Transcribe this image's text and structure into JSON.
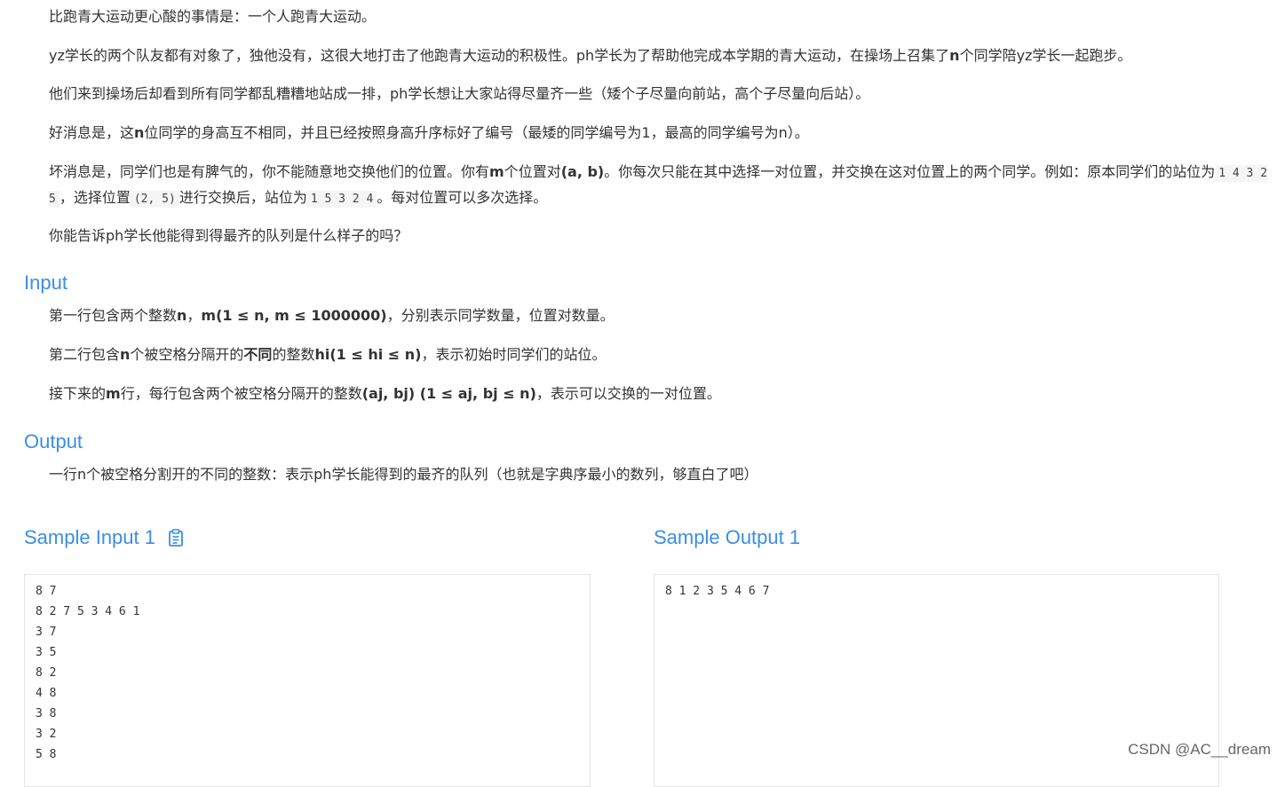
{
  "description": {
    "p1": "比跑青大运动更心酸的事情是：一个人跑青大运动。",
    "p2": {
      "a": "yz学长的两个队友都有对象了，独他没有，这很大地打击了他跑青大运动的积极性。ph学长为了帮助他完成本学期的青大运动，在操场上召集了",
      "b": "n",
      "c": "个同学陪yz学长一起跑步。"
    },
    "p3": "他们来到操场后却看到所有同学都乱糟糟地站成一排，ph学长想让大家站得尽量齐一些（矮个子尽量向前站，高个子尽量向后站）。",
    "p4": {
      "a": "好消息是，这",
      "b": "n",
      "c": "位同学的身高互不相同，并且已经按照身高升序标好了编号（最矮的同学编号为1，最高的同学编号为n）。"
    },
    "p5": {
      "a": "坏消息是，同学们也是有脾气的，你不能随意地交换他们的位置。你有",
      "b": "m",
      "c": "个位置对",
      "d": "(a, b)",
      "e": "。你每次只能在其中选择一对位置，并交换在这对位置上的两个同学。例如：原本同学们的站位为",
      "code1": "1 4 3 2 5",
      "f": "，选择位置",
      "code2": "(2, 5)",
      "g": "进行交换后，站位为",
      "code3": "1 5 3 2 4",
      "h": "。每对位置可以多次选择。"
    },
    "p6": "你能告诉ph学长他能得到得最齐的队列是什么样子的吗？"
  },
  "input_section": {
    "title": "Input",
    "line1": {
      "a": "第一行包含两个整数",
      "b": "n",
      "c": "，",
      "d": "m(1 ≤ n, m ≤ 1000000)",
      "e": "，分别表示同学数量，位置对数量。"
    },
    "line2": {
      "a": "第二行包含",
      "b": "n",
      "c": "个被空格分隔开的",
      "d": "不同",
      "e": "的整数",
      "f": "hi(1 ≤ hi ≤ n)",
      "g": "，表示初始时同学们的站位。"
    },
    "line3": {
      "a": "接下来的",
      "b": "m",
      "c": "行，每行包含两个被空格分隔开的整数",
      "d": "(aj, bj) (1 ≤ aj, bj ≤ n)",
      "e": "，表示可以交换的一对位置。"
    }
  },
  "output_section": {
    "title": "Output",
    "line1": "一行n个被空格分割开的不同的整数：表示ph学长能得到的最齐的队列（也就是字典序最小的数列，够直白了吧）"
  },
  "sample_input": {
    "title": "Sample Input 1",
    "copy_icon": "clipboard-icon",
    "content": "8 7\n8 2 7 5 3 4 6 1\n3 7\n3 5\n8 2\n4 8\n3 8\n3 2\n5 8"
  },
  "sample_output": {
    "title": "Sample Output 1",
    "content": "8 1 2 3 5 4 6 7"
  },
  "watermark": "CSDN @AC__dream",
  "colors": {
    "accent": "#3a8ee6",
    "text": "#333333"
  }
}
